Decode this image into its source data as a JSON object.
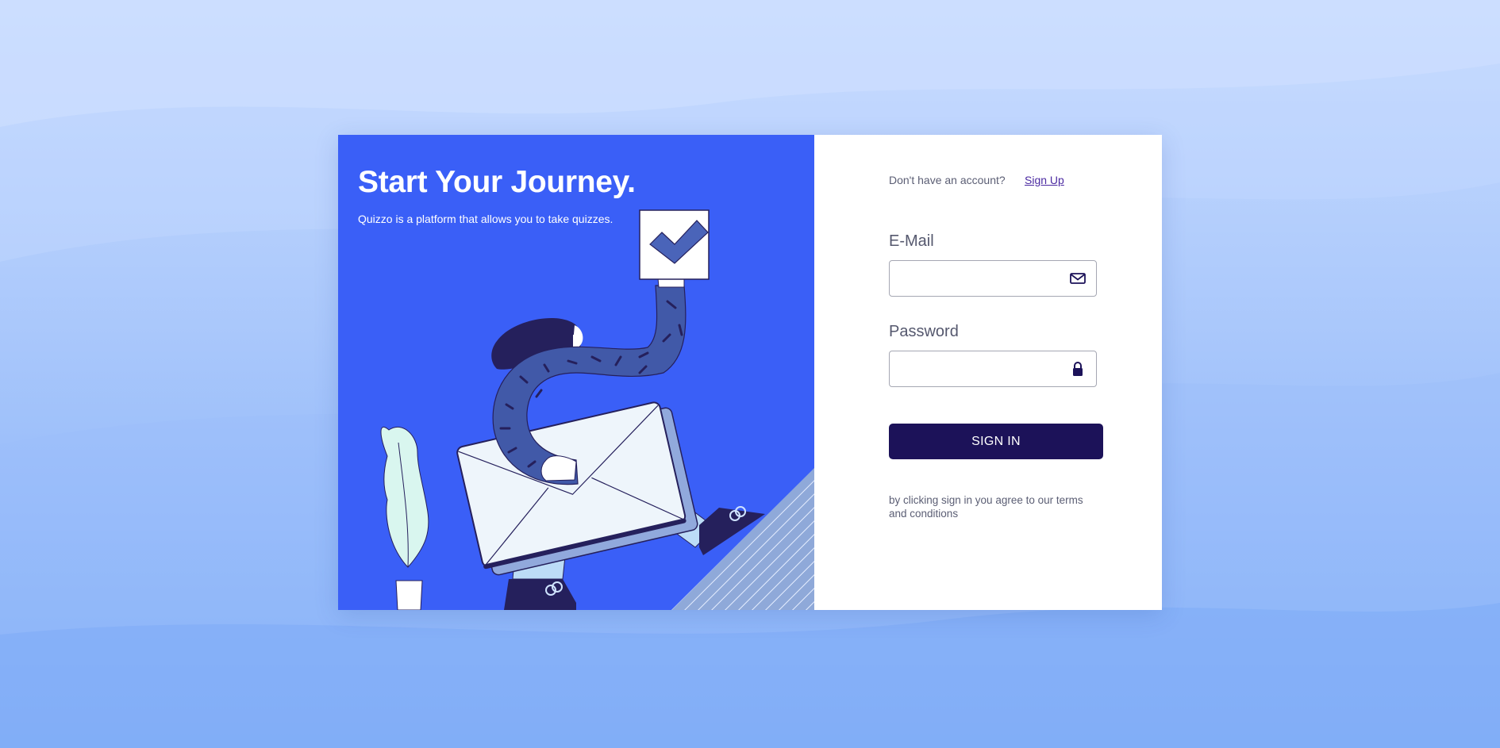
{
  "hero": {
    "title": "Start Your Journey.",
    "subtitle": "Quizzo is a platform that allows you to take quizzes."
  },
  "auth": {
    "no_account_text": "Don't have an account?",
    "signup_link": "Sign Up",
    "email_label": "E-Mail",
    "email_value": "",
    "password_label": "Password",
    "password_value": "",
    "signin_button": "SIGN IN",
    "terms_text": "by clicking sign in you agree to our terms and conditions"
  },
  "icons": {
    "email": "mail-icon",
    "password": "lock-icon"
  },
  "colors": {
    "hero_bg": "#3a5ff7",
    "button_bg": "#1c1259",
    "link": "#4b2aa1"
  }
}
